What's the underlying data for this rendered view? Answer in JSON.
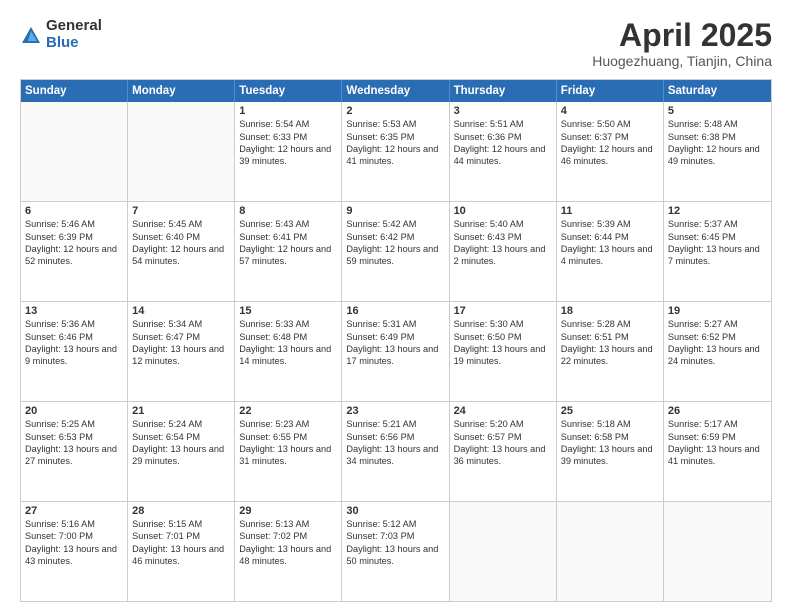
{
  "logo": {
    "general": "General",
    "blue": "Blue"
  },
  "title": "April 2025",
  "location": "Huogezhuang, Tianjin, China",
  "header_days": [
    "Sunday",
    "Monday",
    "Tuesday",
    "Wednesday",
    "Thursday",
    "Friday",
    "Saturday"
  ],
  "rows": [
    [
      {
        "day": "",
        "sunrise": "",
        "sunset": "",
        "daylight": "",
        "empty": true
      },
      {
        "day": "",
        "sunrise": "",
        "sunset": "",
        "daylight": "",
        "empty": true
      },
      {
        "day": "1",
        "sunrise": "Sunrise: 5:54 AM",
        "sunset": "Sunset: 6:33 PM",
        "daylight": "Daylight: 12 hours and 39 minutes."
      },
      {
        "day": "2",
        "sunrise": "Sunrise: 5:53 AM",
        "sunset": "Sunset: 6:35 PM",
        "daylight": "Daylight: 12 hours and 41 minutes."
      },
      {
        "day": "3",
        "sunrise": "Sunrise: 5:51 AM",
        "sunset": "Sunset: 6:36 PM",
        "daylight": "Daylight: 12 hours and 44 minutes."
      },
      {
        "day": "4",
        "sunrise": "Sunrise: 5:50 AM",
        "sunset": "Sunset: 6:37 PM",
        "daylight": "Daylight: 12 hours and 46 minutes."
      },
      {
        "day": "5",
        "sunrise": "Sunrise: 5:48 AM",
        "sunset": "Sunset: 6:38 PM",
        "daylight": "Daylight: 12 hours and 49 minutes."
      }
    ],
    [
      {
        "day": "6",
        "sunrise": "Sunrise: 5:46 AM",
        "sunset": "Sunset: 6:39 PM",
        "daylight": "Daylight: 12 hours and 52 minutes."
      },
      {
        "day": "7",
        "sunrise": "Sunrise: 5:45 AM",
        "sunset": "Sunset: 6:40 PM",
        "daylight": "Daylight: 12 hours and 54 minutes."
      },
      {
        "day": "8",
        "sunrise": "Sunrise: 5:43 AM",
        "sunset": "Sunset: 6:41 PM",
        "daylight": "Daylight: 12 hours and 57 minutes."
      },
      {
        "day": "9",
        "sunrise": "Sunrise: 5:42 AM",
        "sunset": "Sunset: 6:42 PM",
        "daylight": "Daylight: 12 hours and 59 minutes."
      },
      {
        "day": "10",
        "sunrise": "Sunrise: 5:40 AM",
        "sunset": "Sunset: 6:43 PM",
        "daylight": "Daylight: 13 hours and 2 minutes."
      },
      {
        "day": "11",
        "sunrise": "Sunrise: 5:39 AM",
        "sunset": "Sunset: 6:44 PM",
        "daylight": "Daylight: 13 hours and 4 minutes."
      },
      {
        "day": "12",
        "sunrise": "Sunrise: 5:37 AM",
        "sunset": "Sunset: 6:45 PM",
        "daylight": "Daylight: 13 hours and 7 minutes."
      }
    ],
    [
      {
        "day": "13",
        "sunrise": "Sunrise: 5:36 AM",
        "sunset": "Sunset: 6:46 PM",
        "daylight": "Daylight: 13 hours and 9 minutes."
      },
      {
        "day": "14",
        "sunrise": "Sunrise: 5:34 AM",
        "sunset": "Sunset: 6:47 PM",
        "daylight": "Daylight: 13 hours and 12 minutes."
      },
      {
        "day": "15",
        "sunrise": "Sunrise: 5:33 AM",
        "sunset": "Sunset: 6:48 PM",
        "daylight": "Daylight: 13 hours and 14 minutes."
      },
      {
        "day": "16",
        "sunrise": "Sunrise: 5:31 AM",
        "sunset": "Sunset: 6:49 PM",
        "daylight": "Daylight: 13 hours and 17 minutes."
      },
      {
        "day": "17",
        "sunrise": "Sunrise: 5:30 AM",
        "sunset": "Sunset: 6:50 PM",
        "daylight": "Daylight: 13 hours and 19 minutes."
      },
      {
        "day": "18",
        "sunrise": "Sunrise: 5:28 AM",
        "sunset": "Sunset: 6:51 PM",
        "daylight": "Daylight: 13 hours and 22 minutes."
      },
      {
        "day": "19",
        "sunrise": "Sunrise: 5:27 AM",
        "sunset": "Sunset: 6:52 PM",
        "daylight": "Daylight: 13 hours and 24 minutes."
      }
    ],
    [
      {
        "day": "20",
        "sunrise": "Sunrise: 5:25 AM",
        "sunset": "Sunset: 6:53 PM",
        "daylight": "Daylight: 13 hours and 27 minutes."
      },
      {
        "day": "21",
        "sunrise": "Sunrise: 5:24 AM",
        "sunset": "Sunset: 6:54 PM",
        "daylight": "Daylight: 13 hours and 29 minutes."
      },
      {
        "day": "22",
        "sunrise": "Sunrise: 5:23 AM",
        "sunset": "Sunset: 6:55 PM",
        "daylight": "Daylight: 13 hours and 31 minutes."
      },
      {
        "day": "23",
        "sunrise": "Sunrise: 5:21 AM",
        "sunset": "Sunset: 6:56 PM",
        "daylight": "Daylight: 13 hours and 34 minutes."
      },
      {
        "day": "24",
        "sunrise": "Sunrise: 5:20 AM",
        "sunset": "Sunset: 6:57 PM",
        "daylight": "Daylight: 13 hours and 36 minutes."
      },
      {
        "day": "25",
        "sunrise": "Sunrise: 5:18 AM",
        "sunset": "Sunset: 6:58 PM",
        "daylight": "Daylight: 13 hours and 39 minutes."
      },
      {
        "day": "26",
        "sunrise": "Sunrise: 5:17 AM",
        "sunset": "Sunset: 6:59 PM",
        "daylight": "Daylight: 13 hours and 41 minutes."
      }
    ],
    [
      {
        "day": "27",
        "sunrise": "Sunrise: 5:16 AM",
        "sunset": "Sunset: 7:00 PM",
        "daylight": "Daylight: 13 hours and 43 minutes."
      },
      {
        "day": "28",
        "sunrise": "Sunrise: 5:15 AM",
        "sunset": "Sunset: 7:01 PM",
        "daylight": "Daylight: 13 hours and 46 minutes."
      },
      {
        "day": "29",
        "sunrise": "Sunrise: 5:13 AM",
        "sunset": "Sunset: 7:02 PM",
        "daylight": "Daylight: 13 hours and 48 minutes."
      },
      {
        "day": "30",
        "sunrise": "Sunrise: 5:12 AM",
        "sunset": "Sunset: 7:03 PM",
        "daylight": "Daylight: 13 hours and 50 minutes."
      },
      {
        "day": "",
        "sunrise": "",
        "sunset": "",
        "daylight": "",
        "empty": true
      },
      {
        "day": "",
        "sunrise": "",
        "sunset": "",
        "daylight": "",
        "empty": true
      },
      {
        "day": "",
        "sunrise": "",
        "sunset": "",
        "daylight": "",
        "empty": true
      }
    ]
  ]
}
